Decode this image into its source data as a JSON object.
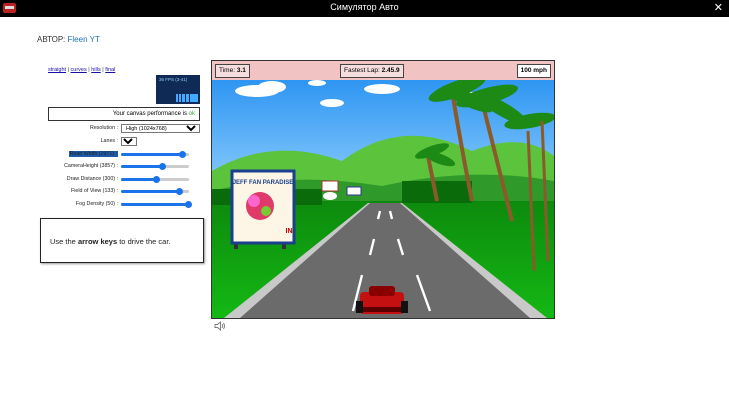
{
  "window": {
    "title": "Симулятор Авто",
    "close_symbol": "✕"
  },
  "author": {
    "prefix": "АВТОР:",
    "name": "Fleen YT"
  },
  "links": {
    "straight": "straight",
    "curves": "curves",
    "hills": "hills",
    "final": "final",
    "sep": " | "
  },
  "fps": {
    "text": "36 FPS (3-41)"
  },
  "performance": {
    "text": "Your canvas performance is ",
    "status": "ok"
  },
  "settings": {
    "resolution": {
      "label": "Resolution :",
      "value": "High (1024x768)"
    },
    "lanes": {
      "label": "Lanes :",
      "value": "3"
    },
    "road_width": {
      "label": "Road Width (2971) :",
      "value": 0.9
    },
    "camera_height": {
      "label": "CameraHeight (3857) :",
      "value": 0.6
    },
    "draw_distance": {
      "label": "Draw Distance (300) :",
      "value": 0.52
    },
    "field_of_view": {
      "label": "Field of View (133) :",
      "value": 0.86
    },
    "fog_density": {
      "label": "Fog Density (50) :",
      "value": 0.98
    }
  },
  "instructions": {
    "before": "Use the ",
    "keys": "arrow keys",
    "after": " to drive the car."
  },
  "hud": {
    "time_label": "Time: ",
    "time_value": "3.1",
    "fastest_label": "Fastest Lap: ",
    "fastest_value": "2.45.9",
    "speed": "100 mph"
  },
  "billboard": {
    "text": "JEFF FAN PARADISE",
    "sign": "IN"
  },
  "colors": {
    "sky": "#3fa9ff",
    "grass": "#10aa10",
    "road": "#6b6b6b",
    "hud": "#f2c3c3",
    "accent": "#1a73e8"
  }
}
